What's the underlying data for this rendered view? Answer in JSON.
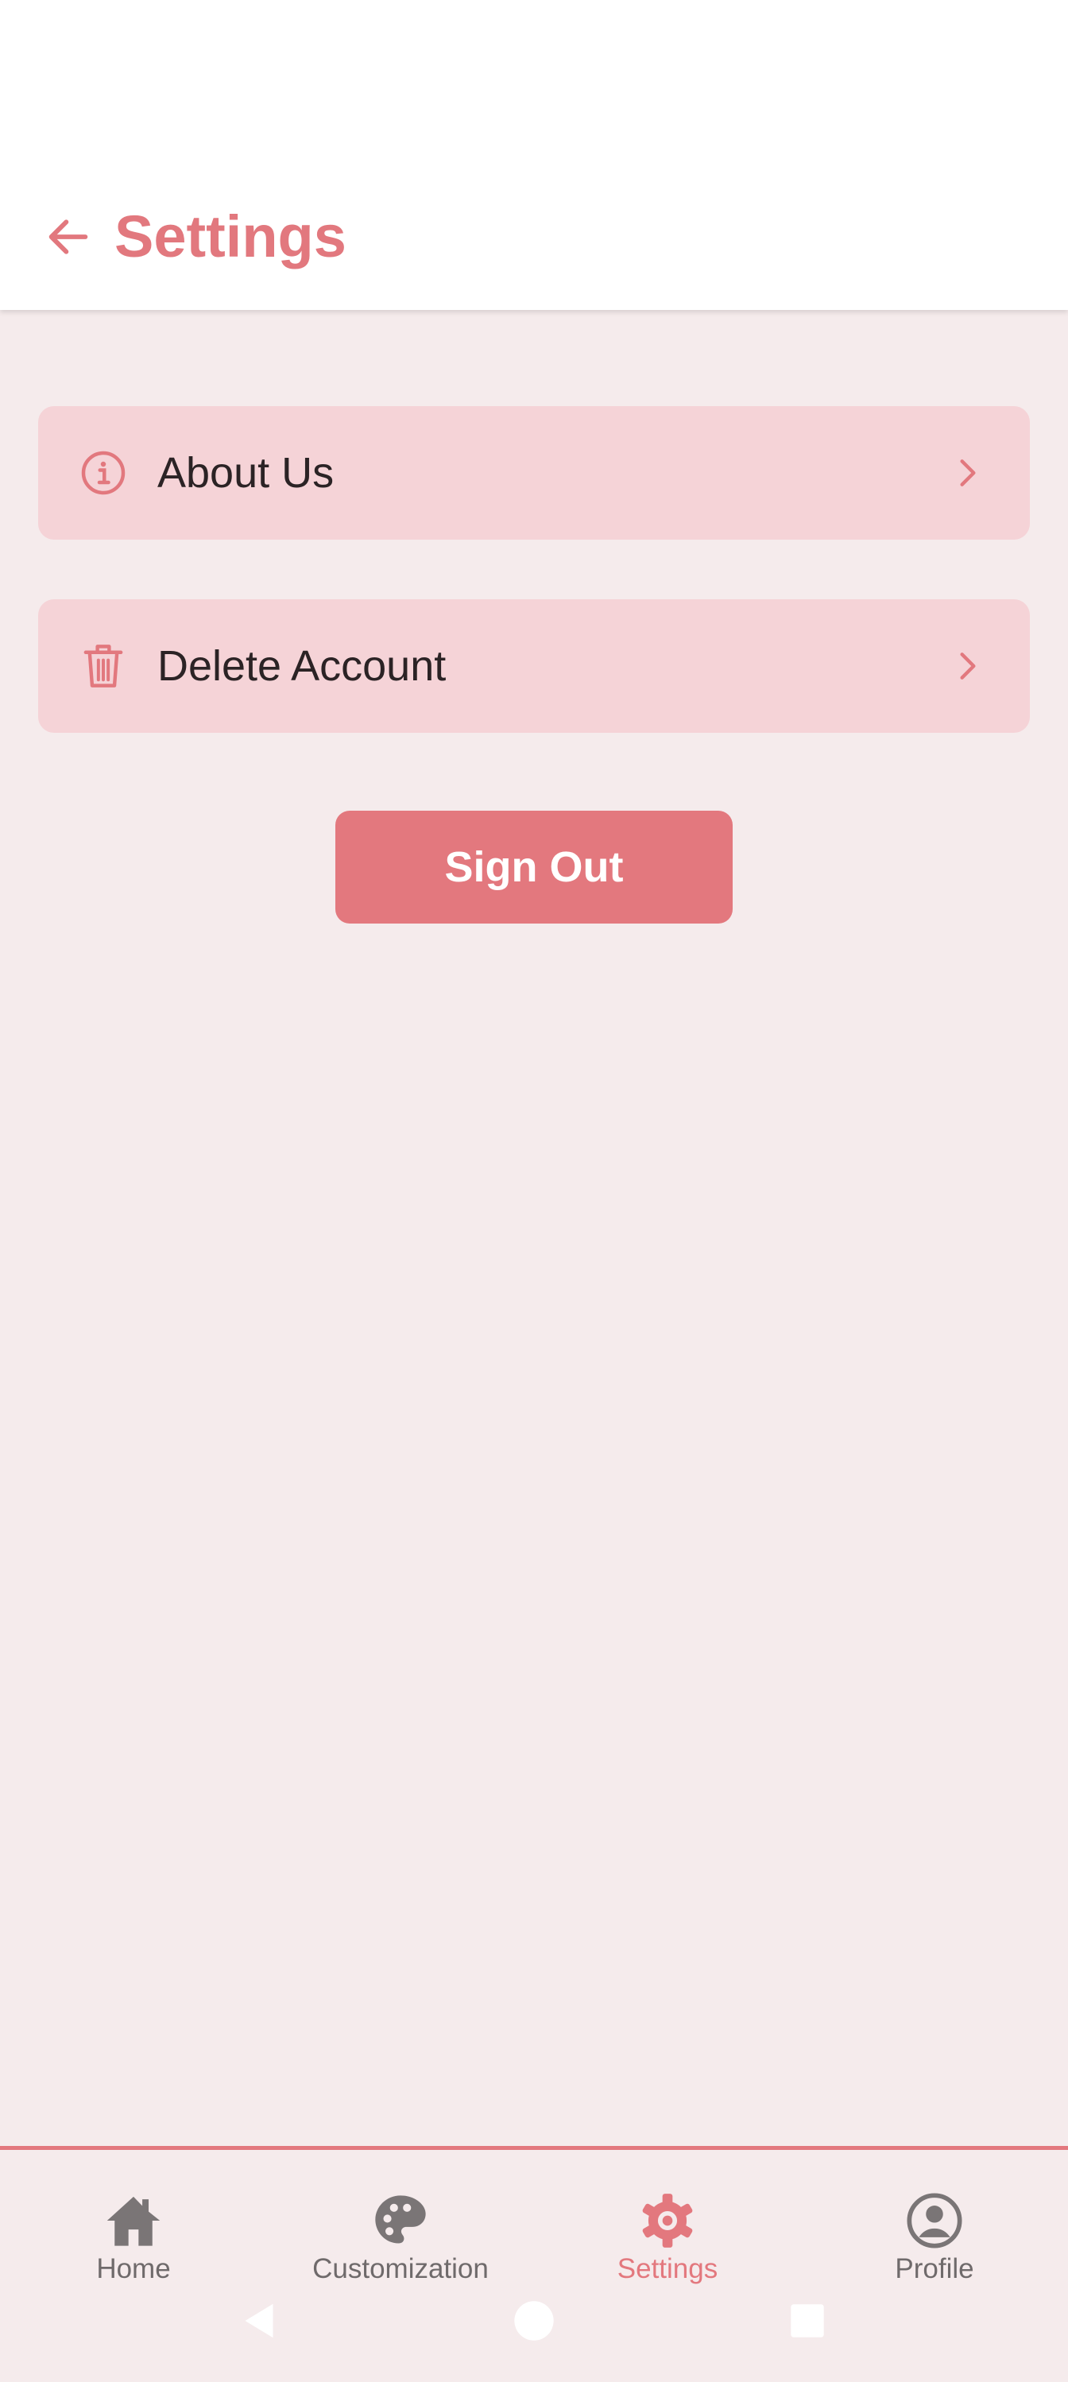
{
  "header": {
    "title": "Settings",
    "back_icon": "arrow-left-icon"
  },
  "settings": {
    "items": [
      {
        "label": "About Us",
        "icon": "info-circle-icon",
        "trailing_icon": "chevron-right-icon"
      },
      {
        "label": "Delete Account",
        "icon": "trash-icon",
        "trailing_icon": "chevron-right-icon"
      }
    ],
    "sign_out_label": "Sign Out"
  },
  "bottom_nav": {
    "items": [
      {
        "label": "Home",
        "icon": "home-icon",
        "active": false
      },
      {
        "label": "Customization",
        "icon": "palette-icon",
        "active": false
      },
      {
        "label": "Settings",
        "icon": "gear-icon",
        "active": true
      },
      {
        "label": "Profile",
        "icon": "user-circle-icon",
        "active": false
      }
    ]
  },
  "system_nav": {
    "buttons": [
      "back-triangle-icon",
      "home-circle-icon",
      "recents-square-icon"
    ]
  },
  "colors": {
    "accent": "#e3787e",
    "background": "#f5ebec",
    "card": "#f5d3d7",
    "inactive": "#6f6a6b",
    "text": "#2b2325"
  }
}
